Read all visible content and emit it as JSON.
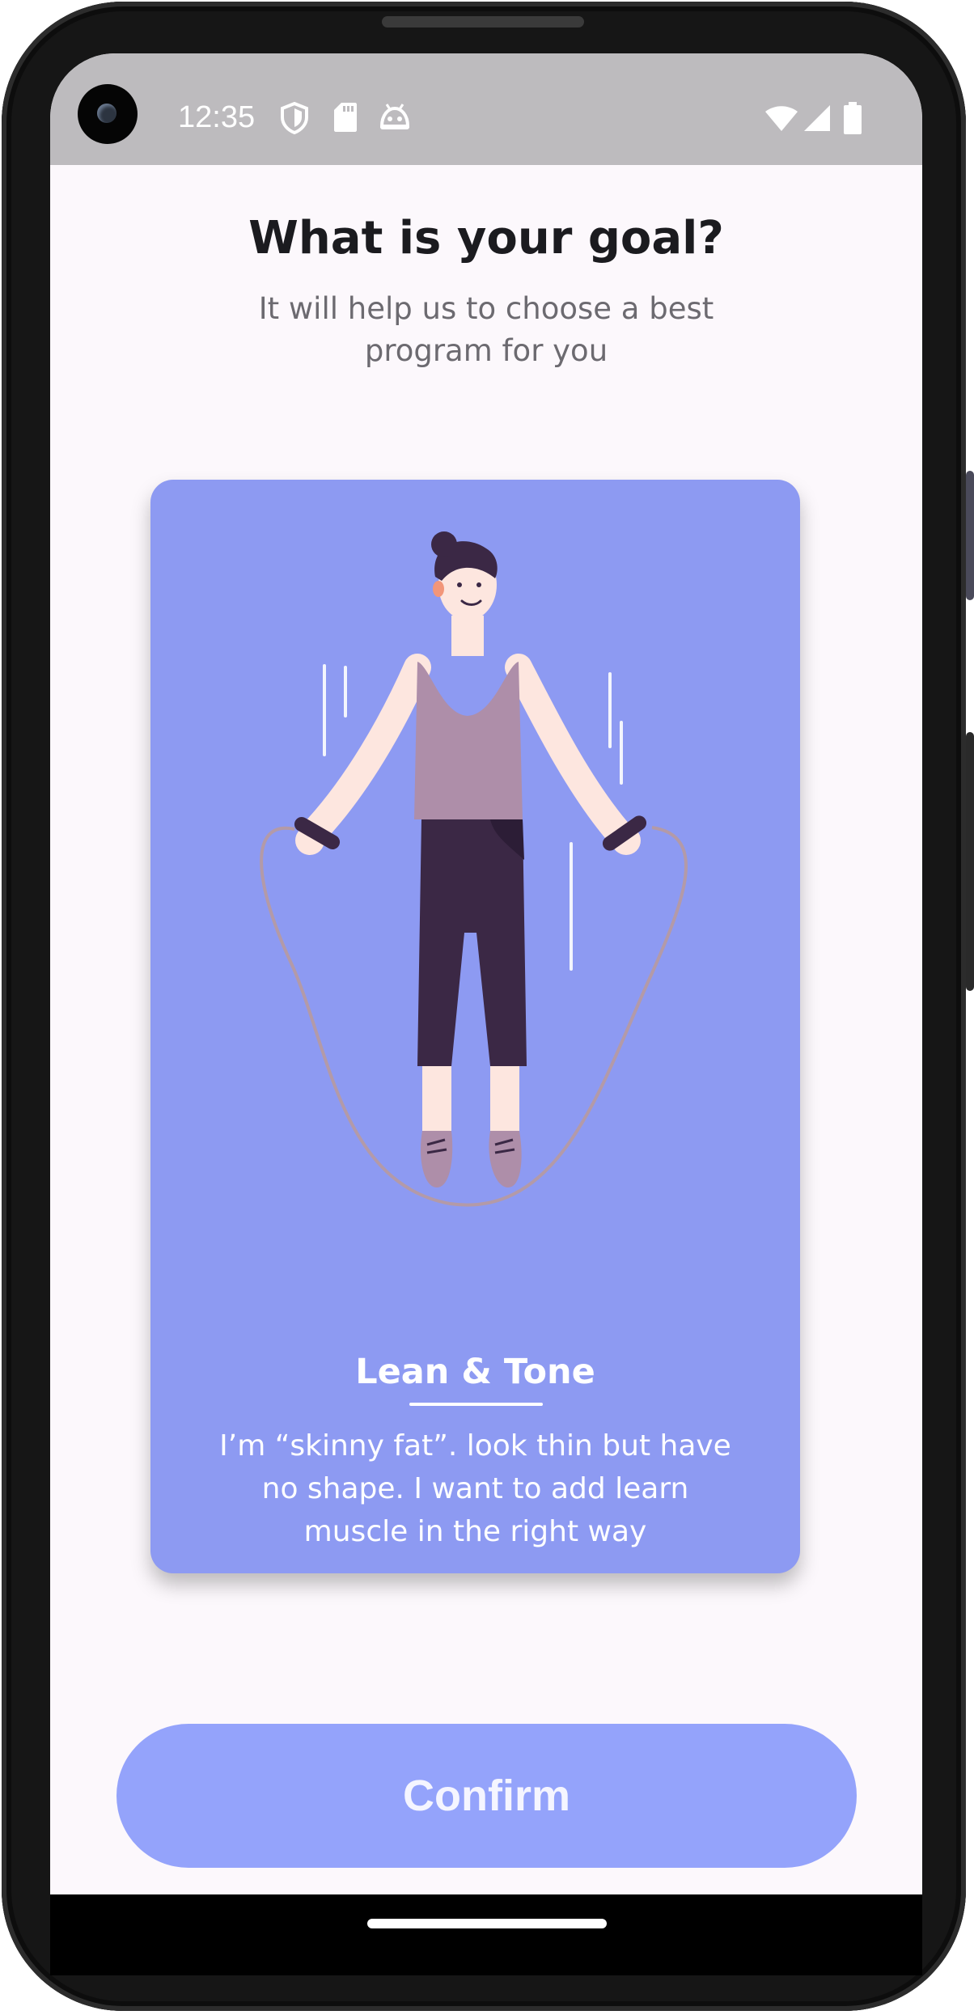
{
  "status_bar": {
    "time": "12:35",
    "icons": [
      "shield-icon",
      "sd-card-icon",
      "android-head-icon",
      "wifi-icon",
      "signal-icon",
      "battery-icon"
    ]
  },
  "header": {
    "title": "What is your goal?",
    "subtitle": "It will help us to choose a best program for you"
  },
  "goal_card": {
    "title": "Lean & Tone",
    "description": "I’m “skinny fat”. look thin but have no shape. I want to add learn muscle in the right way",
    "illustration": "person-jumping-rope",
    "background_color": "#8d9af2"
  },
  "confirm_button": {
    "label": "Confirm",
    "color": "#94a3fb"
  }
}
